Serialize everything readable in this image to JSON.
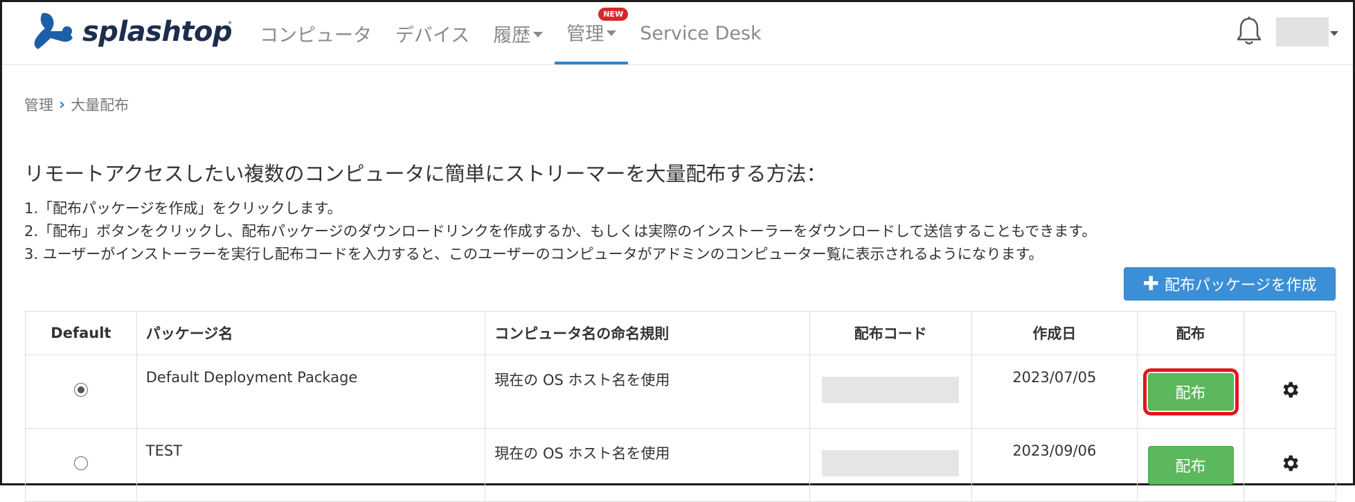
{
  "brand": {
    "name": "splashtop",
    "mark": "°"
  },
  "nav": {
    "items": [
      {
        "label": "コンピュータ"
      },
      {
        "label": "デバイス"
      },
      {
        "label": "履歴"
      },
      {
        "label": "管理",
        "badge": "NEW"
      },
      {
        "label": "Service Desk"
      }
    ]
  },
  "breadcrumb": {
    "parent": "管理",
    "separator": "›",
    "current": "大量配布"
  },
  "heading": "リモートアクセスしたい複数のコンピュータに簡単にストリーマーを大量配布する方法：",
  "steps": [
    "1.「配布パッケージを作成」をクリックします。",
    "2.「配布」ボタンをクリックし、配布パッケージのダウンロードリンクを作成するか、もしくは実際のインストーラーをダウンロードして送信することもできます。",
    "3. ユーザーがインストーラーを実行し配布コードを入力すると、このユーザーのコンピュータがアドミンのコンピューター覧に表示されるようになります。"
  ],
  "create_button": {
    "label": "配布パッケージを作成",
    "icon": "plus-icon",
    "color": "#3b8fd6"
  },
  "table": {
    "headers": {
      "default": "Default",
      "name": "パッケージ名",
      "rule": "コンピュータ名の命名規則",
      "code": "配布コード",
      "date": "作成日",
      "distribute": "配布"
    },
    "rows": [
      {
        "default": true,
        "name": "Default Deployment Package",
        "rule": "現在の OS ホスト名を使用",
        "date": "2023/07/05",
        "distribute_label": "配布",
        "highlighted": true
      },
      {
        "default": false,
        "name": "TEST",
        "rule": "現在の OS ホスト名を使用",
        "date": "2023/09/06",
        "distribute_label": "配布",
        "highlighted": false
      }
    ]
  },
  "colors": {
    "accent": "#2b86c8",
    "distribute": "#5cb85c",
    "highlight": "#e3161c",
    "badge": "#d9262b"
  },
  "icons": {
    "bell": "bell-icon",
    "gear": "gear-icon",
    "user_caret": "chevron-down-icon"
  }
}
